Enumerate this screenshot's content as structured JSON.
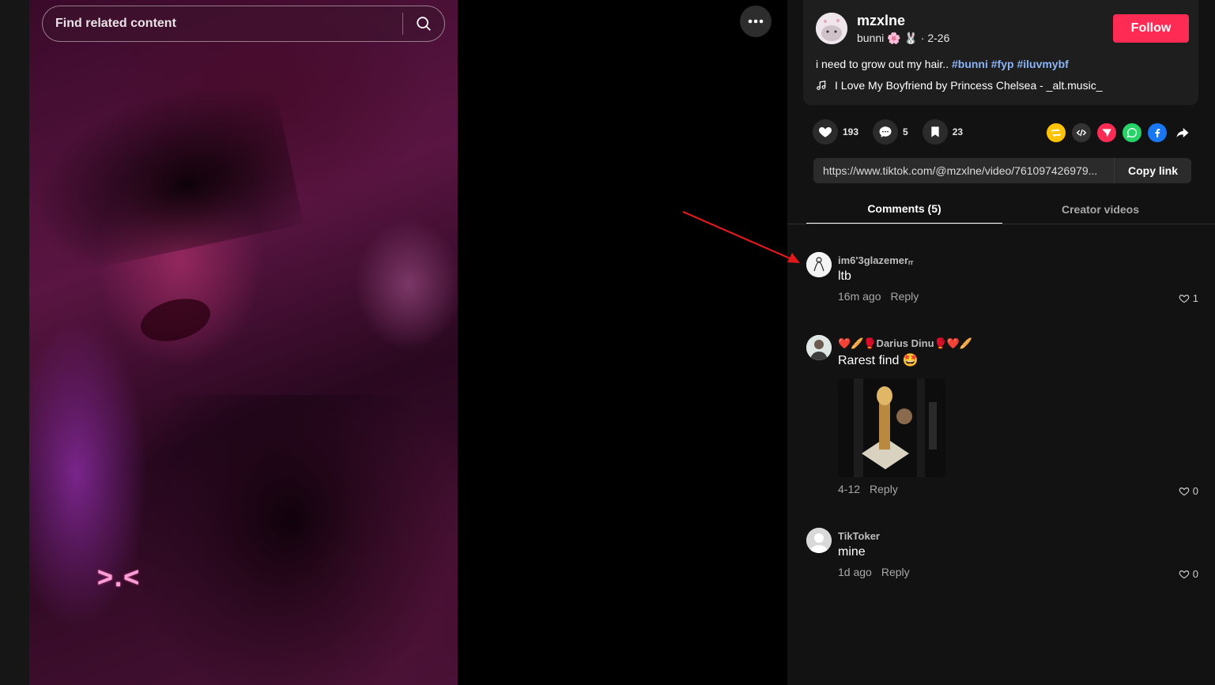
{
  "search": {
    "placeholder": "Find related content"
  },
  "video": {
    "sticker_text": ">.<"
  },
  "author": {
    "username": "mzxlne",
    "display_name": "bunni 🌸 🐰",
    "date": " · 2-26",
    "follow_label": "Follow"
  },
  "caption": {
    "text": "i need to grow out my hair.. ",
    "hashtags": [
      "#bunni",
      "#fyp",
      "#iluvmybf"
    ],
    "music": "I Love My Boyfriend by Princess Chelsea - _alt.music_"
  },
  "stats": {
    "likes": "193",
    "comments": "5",
    "saves": "23"
  },
  "share_icons": [
    "repost-icon",
    "embed-icon",
    "send-icon",
    "whatsapp-icon",
    "facebook-icon",
    "share-arrow-icon"
  ],
  "colors": {
    "accent": "#fe2c55",
    "hashtag": "#8ab4f8",
    "repost": "#ffc300",
    "whatsapp": "#25d366",
    "facebook": "#1877f2"
  },
  "link": {
    "url": "https://www.tiktok.com/@mzxlne/video/761097426979...",
    "copy_label": "Copy link"
  },
  "tabs": [
    {
      "label": "Comments (5)",
      "active": true
    },
    {
      "label": "Creator videos",
      "active": false
    }
  ],
  "comments": [
    {
      "name": "im6'3glazemerᵣᵣ",
      "text": "ltb",
      "time": "16m ago",
      "reply": "Reply",
      "likes": "1"
    },
    {
      "name": "❤️🥖🥊Darius Dinu🥊❤️🥖",
      "text": "Rarest find 🤩",
      "time": "4-12",
      "reply": "Reply",
      "likes": "0"
    },
    {
      "name": "TikToker",
      "text": "mine",
      "time": "1d ago",
      "reply": "Reply",
      "likes": "0"
    }
  ]
}
